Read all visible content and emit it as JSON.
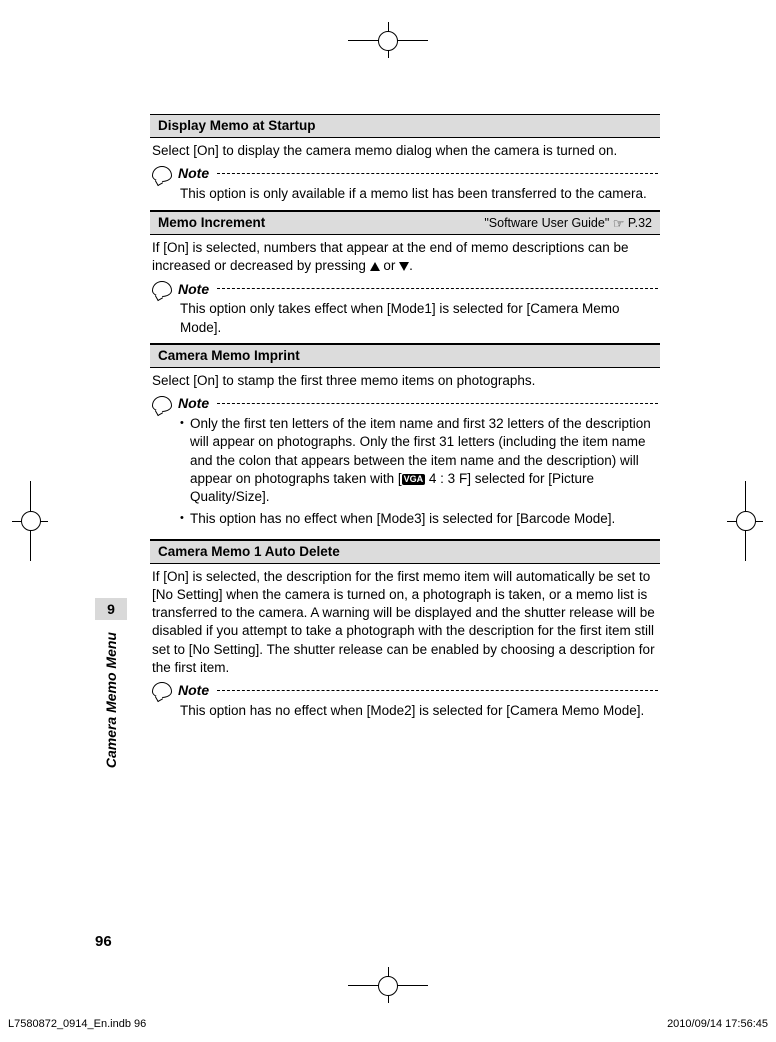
{
  "side": {
    "tab": "9",
    "label": "Camera Memo Menu"
  },
  "page_number": "96",
  "footer": {
    "left": "L7580872_0914_En.indb   96",
    "right": "2010/09/14   17:56:45"
  },
  "sections": {
    "display_memo": {
      "title": "Display Memo at Startup",
      "body": "Select [On] to display the camera memo dialog when the camera is turned on.",
      "note_label": "Note",
      "note_text": "This option is only available if a memo list has been transferred to the camera."
    },
    "memo_increment": {
      "title": "Memo Increment",
      "ref_text": "\"Software User Guide\"",
      "ref_page": "P.32",
      "body_before": "If [On] is selected, numbers that appear at the end of memo descriptions can be increased or decreased by pressing ",
      "body_mid": " or ",
      "body_after": ".",
      "note_label": "Note",
      "note_text": "This option only takes effect when [Mode1] is selected for [Camera Memo Mode]."
    },
    "camera_memo_imprint": {
      "title": "Camera Memo Imprint",
      "body": "Select [On] to stamp the first three memo items on photographs.",
      "note_label": "Note",
      "bullet1_before": "Only the first ten letters of the item name and first 32 letters of the description will appear on photographs. Only the first 31 letters (including the item name and the colon that appears between the item name and the description) will appear on photographs taken with [",
      "bullet1_vga": "VGA",
      "bullet1_after": " 4 : 3 F] selected for [Picture Quality/Size].",
      "bullet2": "This option has no effect when [Mode3] is selected for [Barcode Mode]."
    },
    "auto_delete": {
      "title": "Camera Memo 1 Auto Delete",
      "body": "If [On] is selected, the description for the first memo item will automatically be set to [No Setting] when the camera is turned on, a photograph is taken, or a memo list is transferred to the camera. A warning will be displayed and the shutter release will be disabled if you attempt to take a photograph with the description for the first item still set to [No Setting]. The shutter release can be enabled by choosing a description for the first item.",
      "note_label": "Note",
      "note_text": "This option has no effect when [Mode2] is selected for [Camera Memo Mode]."
    }
  }
}
